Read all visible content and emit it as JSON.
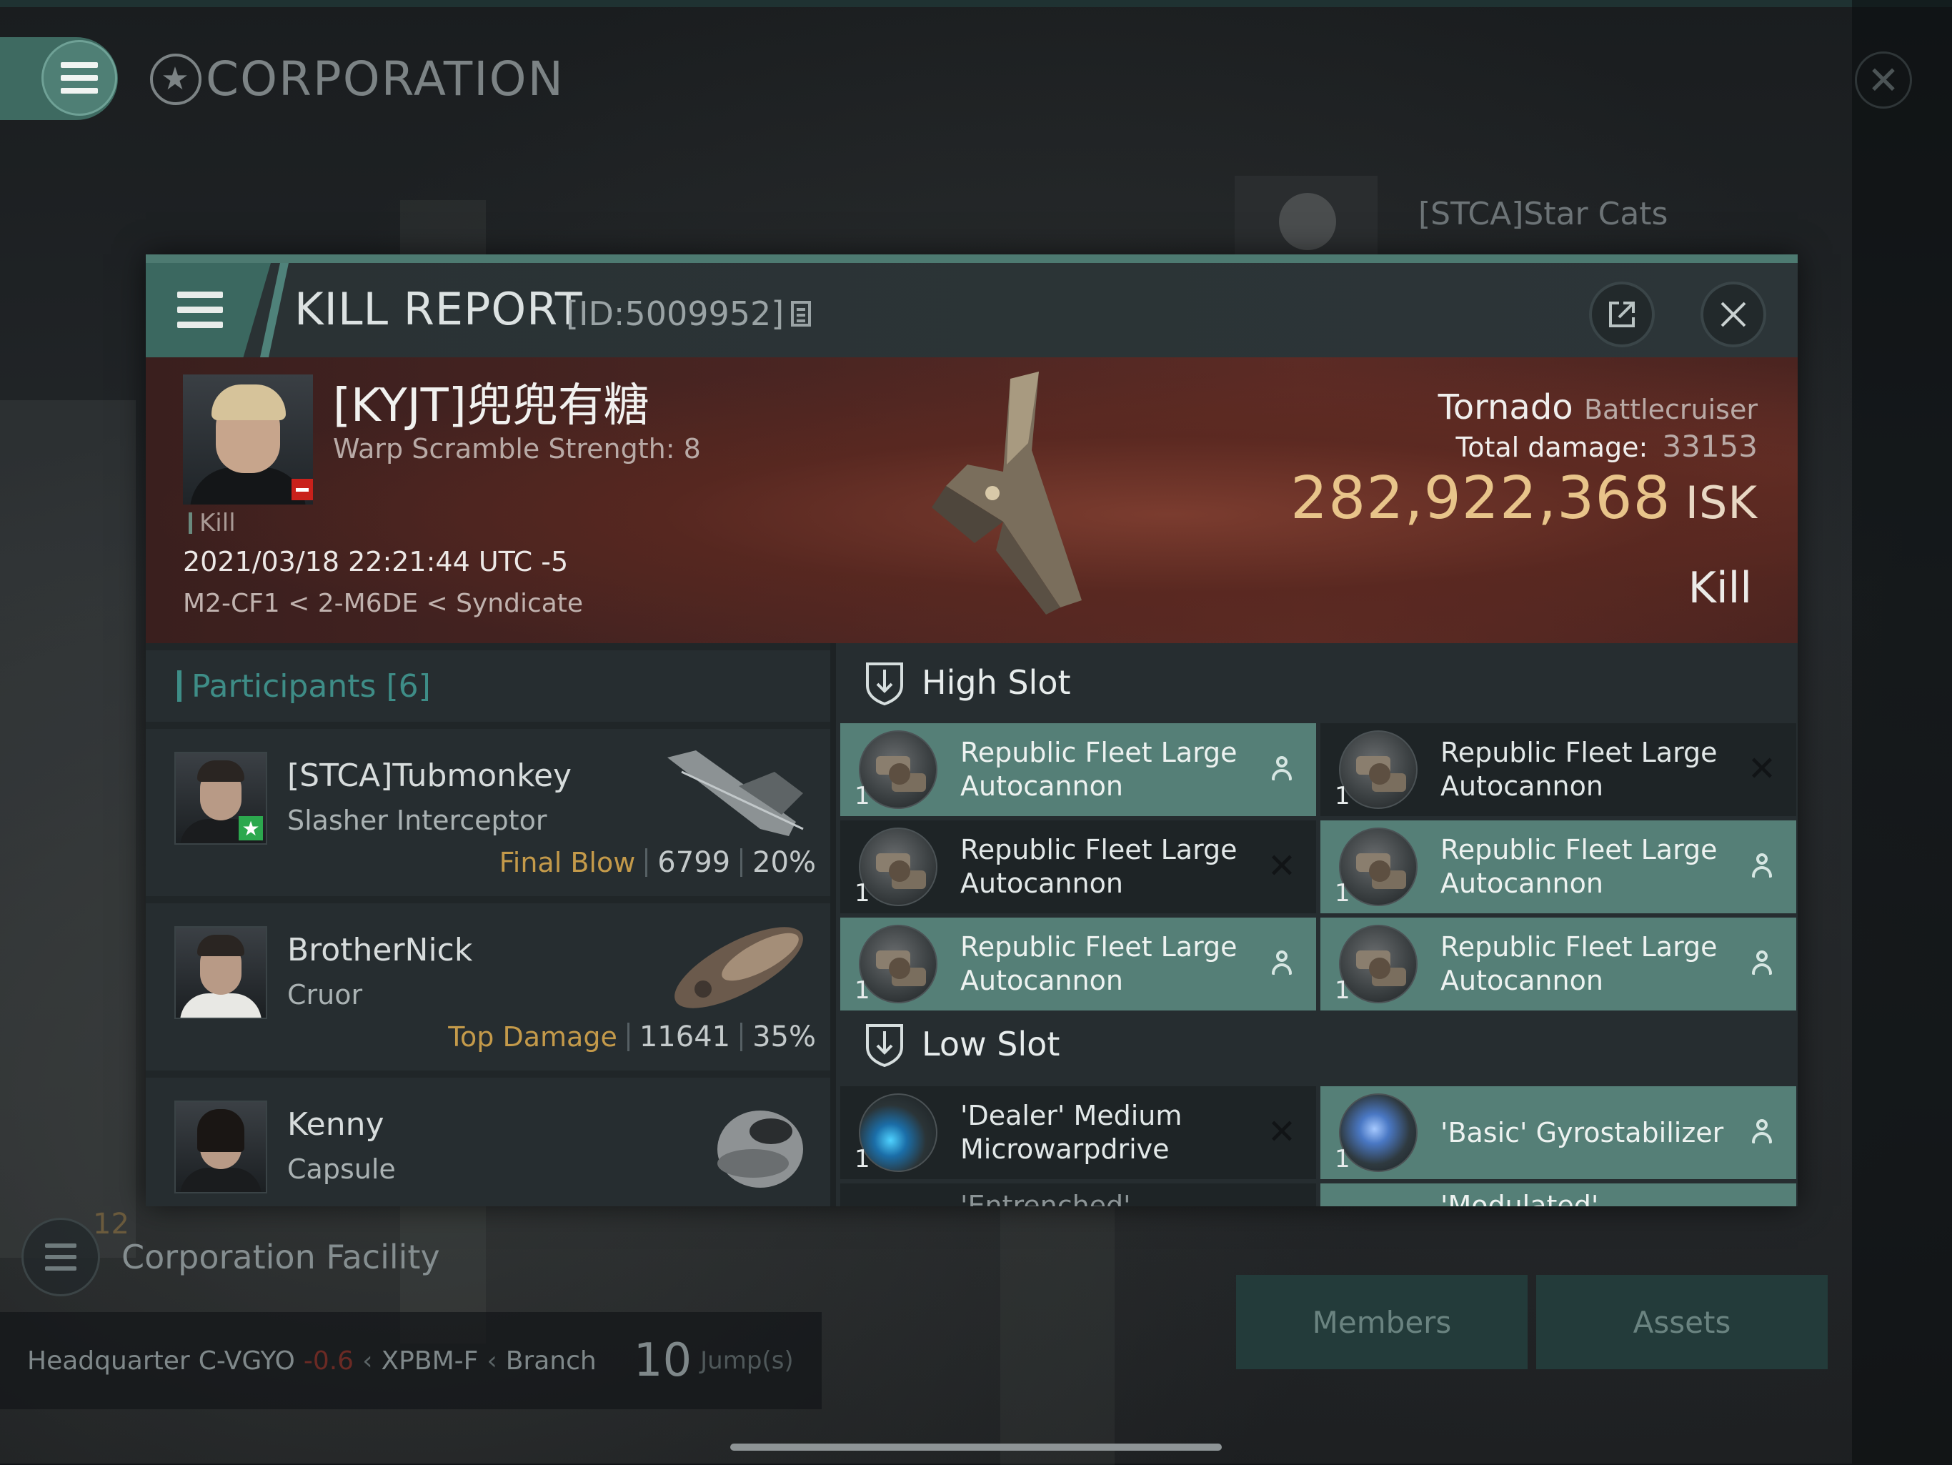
{
  "app": {
    "menu_icon": "hamburger-icon",
    "title": "CORPORATION",
    "title_icon": "star-emblem-icon"
  },
  "background": {
    "corp_name": "[STCA]Star Cats",
    "facility": {
      "count": "12",
      "label": "Corporation Facility"
    },
    "hq": {
      "label": "Headquarter",
      "system": "C-VGYO",
      "security": "-0.6",
      "region": "XPBM-F",
      "type": "Branch",
      "jumps": "10",
      "jumps_label": "Jump(s)"
    },
    "buttons": {
      "members": "Members",
      "assets": "Assets"
    }
  },
  "kill_report": {
    "title": "KILL REPORT",
    "id": "[ID:5009952]",
    "victim": {
      "name": "[KYJT]兜兜有糖",
      "subtitle": "Warp Scramble Strength: 8",
      "kill_tag": "Kill",
      "datetime": "2021/03/18 22:21:44 UTC -5",
      "location": "M2-CF1 < 2-M6DE < Syndicate",
      "ship": "Tornado",
      "ship_class": "Battlecruiser",
      "total_damage_label": "Total damage:",
      "total_damage": "33153",
      "isk_value": "282,922,368",
      "isk_unit": "ISK",
      "result": "Kill"
    },
    "participants": {
      "header": "Participants",
      "count": "[6]",
      "list": [
        {
          "name": "[STCA]Tubmonkey",
          "ship": "Slasher Interceptor",
          "tag": "Final Blow",
          "damage": "6799",
          "percent": "20%"
        },
        {
          "name": "BrotherNick",
          "ship": "Cruor",
          "tag": "Top Damage",
          "damage": "11641",
          "percent": "35%"
        },
        {
          "name": "Kenny",
          "ship": "Capsule"
        }
      ]
    },
    "fitting": {
      "high_slot_label": "High Slot",
      "low_slot_label": "Low Slot",
      "high": [
        {
          "name_l1": "Republic Fleet Large",
          "name_l2": "Autocannon",
          "qty": "1",
          "status": "fitted"
        },
        {
          "name_l1": "Republic Fleet Large",
          "name_l2": "Autocannon",
          "qty": "1",
          "status": "destroyed"
        },
        {
          "name_l1": "Republic Fleet Large",
          "name_l2": "Autocannon",
          "qty": "1",
          "status": "destroyed"
        },
        {
          "name_l1": "Republic Fleet Large",
          "name_l2": "Autocannon",
          "qty": "1",
          "status": "fitted"
        },
        {
          "name_l1": "Republic Fleet Large",
          "name_l2": "Autocannon",
          "qty": "1",
          "status": "fitted"
        },
        {
          "name_l1": "Republic Fleet Large",
          "name_l2": "Autocannon",
          "qty": "1",
          "status": "fitted"
        }
      ],
      "low": [
        {
          "name_l1": "'Dealer' Medium",
          "name_l2": "Microwarpdrive",
          "qty": "1",
          "status": "destroyed"
        },
        {
          "name_l1": "'Basic' Gyrostabilizer",
          "qty": "1",
          "status": "fitted"
        },
        {
          "name_l1": "'Entrenched' Adaptive..."
        },
        {
          "name_l1": "'Modulated' Tracking..."
        }
      ]
    },
    "colors": {
      "accent_teal": "#4d7a71",
      "fitted_bg": "#557f77",
      "isk_gold": "#e8c48a",
      "final_blow": "#c49a4a",
      "participants_header": "#3e8d87"
    }
  }
}
